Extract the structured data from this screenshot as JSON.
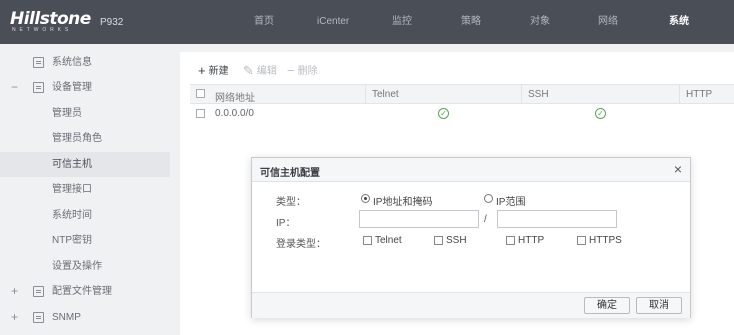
{
  "app": {
    "brand": "Hillstone",
    "brand_sub": "NETWORKS",
    "model": "P932"
  },
  "nav": [
    "首页",
    "iCenter",
    "监控",
    "策略",
    "对象",
    "网络",
    "系统"
  ],
  "sidebar": {
    "items": [
      {
        "label": "系统信息",
        "toggle": "",
        "icon": "system-info-icon"
      },
      {
        "label": "设备管理",
        "toggle": "−",
        "icon": "device-manage-icon"
      },
      {
        "label": "管理员"
      },
      {
        "label": "管理员角色"
      },
      {
        "label": "可信主机"
      },
      {
        "label": "管理接口"
      },
      {
        "label": "系统时间"
      },
      {
        "label": "NTP密钥"
      },
      {
        "label": "设置及操作"
      },
      {
        "label": "配置文件管理",
        "toggle": "+",
        "icon": "config-file-icon"
      },
      {
        "label": "SNMP",
        "toggle": "+",
        "icon": "snmp-icon"
      }
    ]
  },
  "toolbar": {
    "new_label": "新建",
    "edit_label": "编辑",
    "delete_label": "删除"
  },
  "table": {
    "columns": [
      "网络地址",
      "Telnet",
      "SSH",
      "HTTP"
    ],
    "rows": [
      {
        "address": "0.0.0.0/0",
        "telnet": true,
        "ssh": true,
        "http": false
      }
    ]
  },
  "modal": {
    "title": "可信主机配置",
    "close": "×",
    "type_label": "类型：",
    "type_options": [
      "IP地址和掩码",
      "IP范围"
    ],
    "type_selected": "IP地址和掩码",
    "ip_label": "IP：",
    "ip_value": "",
    "mask_value": "",
    "separator": "/",
    "login_label": "登录类型：",
    "login_options": [
      "Telnet",
      "SSH",
      "HTTP",
      "HTTPS"
    ],
    "ok_label": "确定",
    "cancel_label": "取消"
  },
  "colors": {
    "topbar": "#4a4e57",
    "check_green": "#58a65b"
  }
}
